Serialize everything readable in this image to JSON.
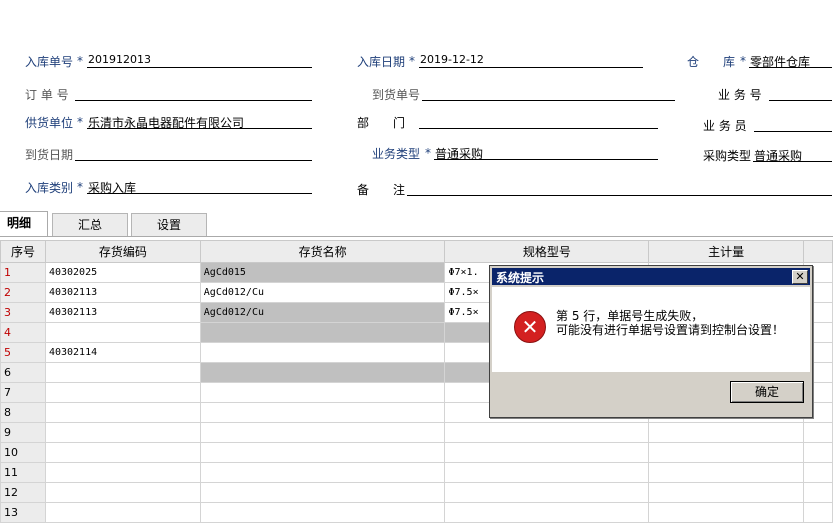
{
  "form": {
    "row1": {
      "receipt_no_label": "入库单号",
      "receipt_no_value": "201912013",
      "receipt_date_label": "入库日期",
      "receipt_date_value": "2019-12-12",
      "warehouse_label": "仓　　库",
      "warehouse_value": "零部件仓库"
    },
    "row2": {
      "order_no_label": "订 单 号",
      "order_no_value": "",
      "arrival_no_label": "到货单号",
      "arrival_no_value": "",
      "business_no_label": "业 务 号",
      "business_no_value": ""
    },
    "row3": {
      "supplier_label": "供货单位",
      "supplier_value": "乐清市永晶电器配件有限公司",
      "department_label": "部　　门",
      "department_value": "",
      "salesperson_label": "业 务 员",
      "salesperson_value": ""
    },
    "row4": {
      "arrival_date_label": "到货日期",
      "arrival_date_value": "",
      "business_type_label": "业务类型",
      "business_type_value": "普通采购",
      "purchase_type_label": "采购类型",
      "purchase_type_value": "普通采购"
    },
    "row5": {
      "receipt_type_label": "入库类别",
      "receipt_type_value": "采购入库",
      "remark_label": "备　　注",
      "remark_value": ""
    },
    "required_mark": "*"
  },
  "tabs": [
    "明细",
    "汇总",
    "设置"
  ],
  "table": {
    "headers": [
      "序号",
      "存货编码",
      "存货名称",
      "规格型号",
      "主计量"
    ],
    "rows": [
      {
        "seq": "1",
        "code": "40302025",
        "name": "AgCd015",
        "spec": "Φ7×1.",
        "unit": ""
      },
      {
        "seq": "2",
        "code": "40302113",
        "name": "AgCd012/Cu",
        "spec": "Φ7.5×",
        "unit": ""
      },
      {
        "seq": "3",
        "code": "40302113",
        "name": "AgCd012/Cu",
        "spec": "Φ7.5×",
        "unit": ""
      },
      {
        "seq": "4",
        "code": "",
        "name": "",
        "spec": "",
        "unit": ""
      },
      {
        "seq": "5",
        "code": "40302114",
        "name": "",
        "spec": "",
        "unit": ""
      },
      {
        "seq": "6",
        "code": "",
        "name": "",
        "spec": "",
        "unit": ""
      },
      {
        "seq": "7",
        "code": "",
        "name": "",
        "spec": "",
        "unit": ""
      },
      {
        "seq": "8",
        "code": "",
        "name": "",
        "spec": "",
        "unit": ""
      },
      {
        "seq": "9",
        "code": "",
        "name": "",
        "spec": "",
        "unit": ""
      },
      {
        "seq": "10",
        "code": "",
        "name": "",
        "spec": "",
        "unit": ""
      },
      {
        "seq": "11",
        "code": "",
        "name": "",
        "spec": "",
        "unit": ""
      },
      {
        "seq": "12",
        "code": "",
        "name": "",
        "spec": "",
        "unit": ""
      },
      {
        "seq": "13",
        "code": "",
        "name": "",
        "spec": "",
        "unit": ""
      }
    ]
  },
  "dialog": {
    "title": "系统提示",
    "close_glyph": "✕",
    "icon": "error-icon",
    "message_line1": "第 5 行，单据号生成失败，",
    "message_line2": "可能没有进行单据号设置请到控制台设置！",
    "ok_label": "确定"
  },
  "colors": {
    "label_blue": "#1f3f7a",
    "seq_red": "#c00000",
    "title_bar": "#0a246a",
    "error_red": "#d32020"
  }
}
